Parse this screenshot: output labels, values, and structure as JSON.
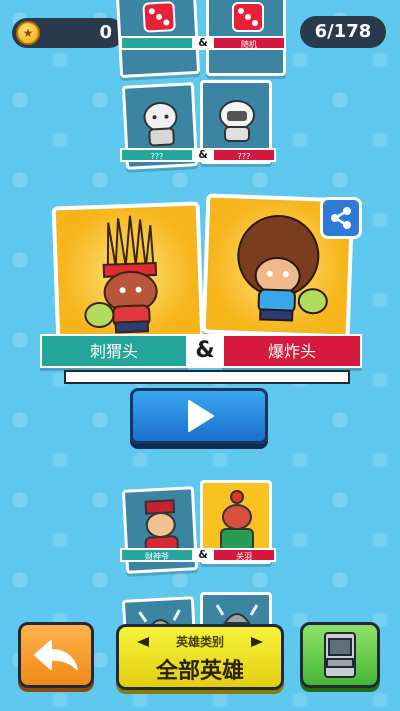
{
  "hud": {
    "coins": "0",
    "plus": "+",
    "progress": "6/178"
  },
  "top_pair": {
    "left_name": "",
    "right_name": "随机",
    "amp": "&"
  },
  "pair_one": {
    "left_name": "???",
    "right_name": "???",
    "amp": "&"
  },
  "main_pair": {
    "left_name": "刺猬头",
    "right_name": "爆炸头",
    "amp": "&"
  },
  "pair_three": {
    "left_name": "财神爷",
    "right_name": "关羽",
    "amp": "&"
  },
  "bottom": {
    "category_label": "英雄类别",
    "category_value": "全部英雄"
  },
  "colors": {
    "background": "#5fc8ee",
    "teal_bar": "#23a59a",
    "red_bar": "#d6193f",
    "play_blue": "#2a8ee0"
  }
}
